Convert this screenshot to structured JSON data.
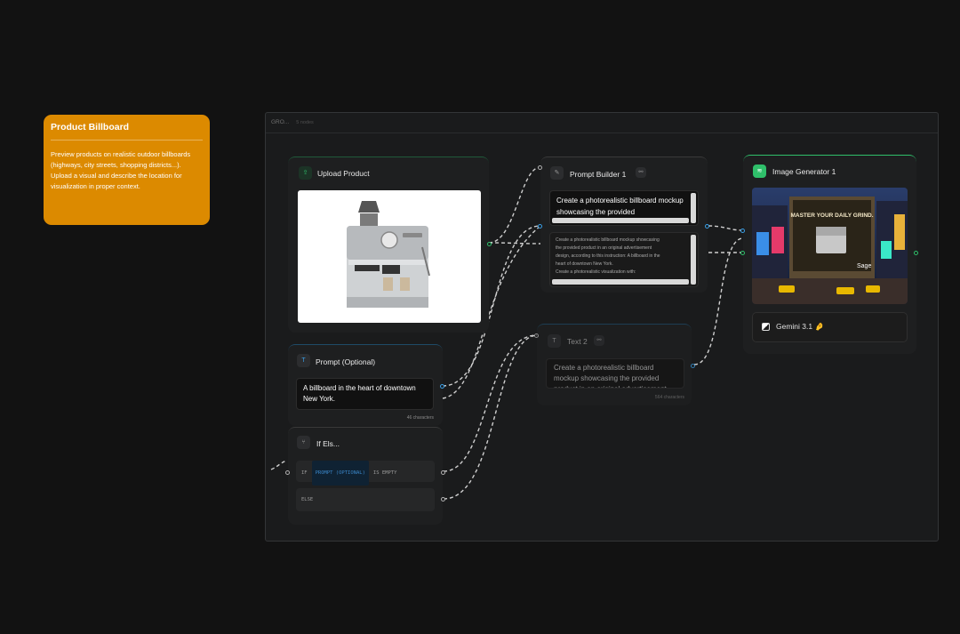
{
  "note": {
    "title": "Product Billboard",
    "body": "Preview products on realistic outdoor billboards (highways, city streets, shopping districts...). Upload a visual and describe the location for visualization in proper context."
  },
  "group": {
    "title": "GRO...",
    "subtitle": "5 nodes"
  },
  "upload": {
    "title": "Upload Product",
    "icon": "upload-icon",
    "image_subject": "espresso machine product photo"
  },
  "prompt_optional": {
    "title": "Prompt (Optional)",
    "icon": "text-icon",
    "value": "A billboard in the heart of downtown New York.",
    "char_count": "46 characters"
  },
  "if_else": {
    "title": "If Els...",
    "if_keyword": "IF",
    "condition_variable": "PROMPT (OPTIONAL)",
    "condition_operator": "IS EMPTY",
    "else_keyword": "ELSE"
  },
  "prompt_builder": {
    "title": "Prompt Builder 1",
    "template_text": "Create a photorealistic billboard mockup showcasing the provided",
    "preview_lines": [
      "Create a photorealistic billboard mockup showcasing",
      "the provided product in an original advertisement",
      "design, according to this instruction: A billboard in the",
      "heart of downtown New York.",
      "Create a photorealistic visualization with:"
    ]
  },
  "text2": {
    "title": "Text 2",
    "value": "Create a photorealistic billboard mockup showcasing the provided product in an original advertisement",
    "char_count": "564 characters"
  },
  "image_gen": {
    "title": "Image Generator 1",
    "model": "Gemini 3.1 🤌",
    "billboard_text": "MASTER YOUR DAILY GRIND.",
    "brand": "Sage"
  },
  "colors": {
    "note": "#dc8a00",
    "green": "#2fbf6a",
    "blue": "#3aa0e8"
  }
}
